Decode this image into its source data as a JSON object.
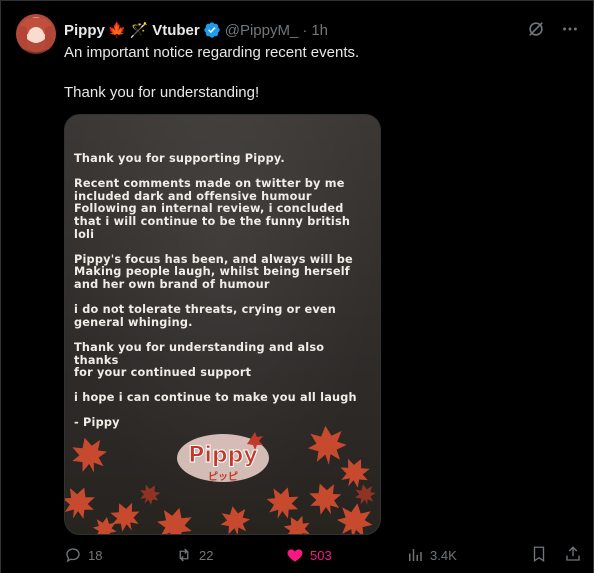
{
  "post": {
    "display_name": "Pippy",
    "name_emojis": [
      "🍁",
      "🪄"
    ],
    "name_suffix": "Vtuber",
    "handle": "@PippyM_",
    "separator": "·",
    "time": "1h",
    "text_line1": "An important notice regarding recent events.",
    "text_line2": "Thank you for understanding!"
  },
  "image": {
    "paragraphs": [
      "Thank you for supporting Pippy.",
      "Recent comments made on twitter by me\nincluded dark and offensive humour\nFollowing an internal review, i concluded\nthat i will continue to be the funny british loli",
      "Pippy's focus has been, and always will be\nMaking people laugh, whilst being herself\nand her own brand of humour",
      "i do not tolerate threats, crying or even\ngeneral whinging.",
      "Thank you for understanding and also thanks\nfor your continued support",
      "i hope i can continue to make you all laugh",
      "- Pippy"
    ],
    "logo_text": "Pippy",
    "logo_subtext": "ピッピ",
    "accent_color": "#c0392b"
  },
  "actions": {
    "replies": "18",
    "reposts": "22",
    "likes": "503",
    "views": "3.4K",
    "like_color": "#f91880"
  }
}
